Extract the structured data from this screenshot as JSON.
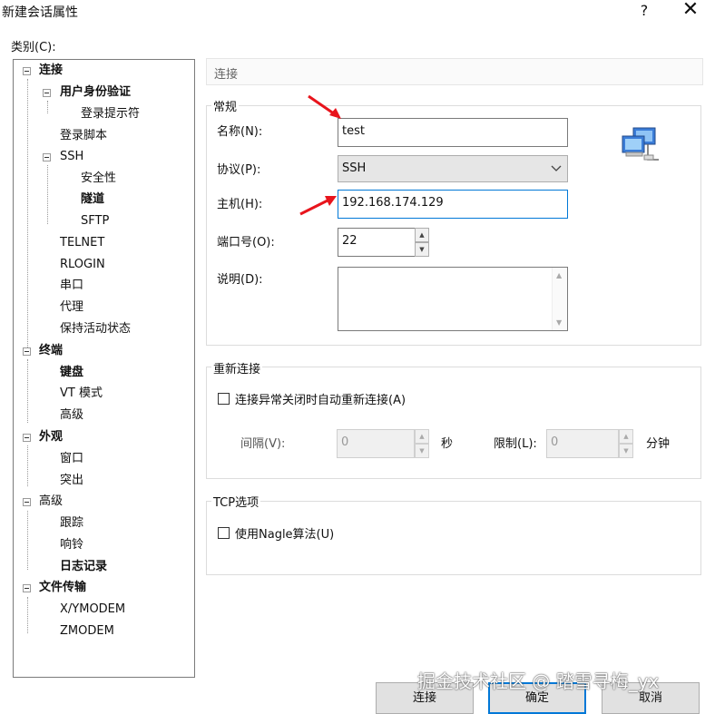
{
  "window": {
    "title": "新建会话属性",
    "help_glyph": "?",
    "close_glyph": "✕"
  },
  "category_label": "类别(C):",
  "tree": {
    "items": [
      {
        "label": "连接",
        "bold": true
      },
      {
        "label": "用户身份验证",
        "bold": true
      },
      {
        "label": "登录提示符",
        "bold": false
      },
      {
        "label": "登录脚本",
        "bold": false
      },
      {
        "label": "SSH",
        "bold": false
      },
      {
        "label": "安全性",
        "bold": false
      },
      {
        "label": "隧道",
        "bold": true
      },
      {
        "label": "SFTP",
        "bold": false
      },
      {
        "label": "TELNET",
        "bold": false
      },
      {
        "label": "RLOGIN",
        "bold": false
      },
      {
        "label": "串口",
        "bold": false
      },
      {
        "label": "代理",
        "bold": false
      },
      {
        "label": "保持活动状态",
        "bold": false
      },
      {
        "label": "终端",
        "bold": true
      },
      {
        "label": "键盘",
        "bold": true
      },
      {
        "label": "VT 模式",
        "bold": false
      },
      {
        "label": "高级",
        "bold": false
      },
      {
        "label": "外观",
        "bold": true
      },
      {
        "label": "窗口",
        "bold": false
      },
      {
        "label": "突出",
        "bold": false
      },
      {
        "label": "高级",
        "bold": false
      },
      {
        "label": "跟踪",
        "bold": false
      },
      {
        "label": "响铃",
        "bold": false
      },
      {
        "label": "日志记录",
        "bold": true
      },
      {
        "label": "文件传输",
        "bold": true
      },
      {
        "label": "X/YMODEM",
        "bold": false
      },
      {
        "label": "ZMODEM",
        "bold": false
      }
    ]
  },
  "panel": {
    "header": "连接",
    "general": {
      "title": "常规",
      "name_label": "名称(N):",
      "name_value": "test",
      "protocol_label": "协议(P):",
      "protocol_value": "SSH",
      "host_label": "主机(H):",
      "host_value": "192.168.174.129",
      "port_label": "端口号(O):",
      "port_value": "22",
      "desc_label": "说明(D):",
      "desc_value": ""
    },
    "reconnect": {
      "title": "重新连接",
      "checkbox_label": "连接异常关闭时自动重新连接(A)",
      "checked": false,
      "interval_label": "间隔(V):",
      "interval_value": "0",
      "interval_unit": "秒",
      "limit_label": "限制(L):",
      "limit_value": "0",
      "limit_unit": "分钟"
    },
    "tcp": {
      "title": "TCP选项",
      "nagle_label": "使用Nagle算法(U)",
      "checked": false
    }
  },
  "buttons": {
    "connect": "连接",
    "ok": "确定",
    "cancel": "取消"
  },
  "watermark": "掘金技术社区 @ 踏雪寻梅_yx",
  "colors": {
    "focus_blue": "#0078d7",
    "annotation_red": "#e8141c"
  }
}
